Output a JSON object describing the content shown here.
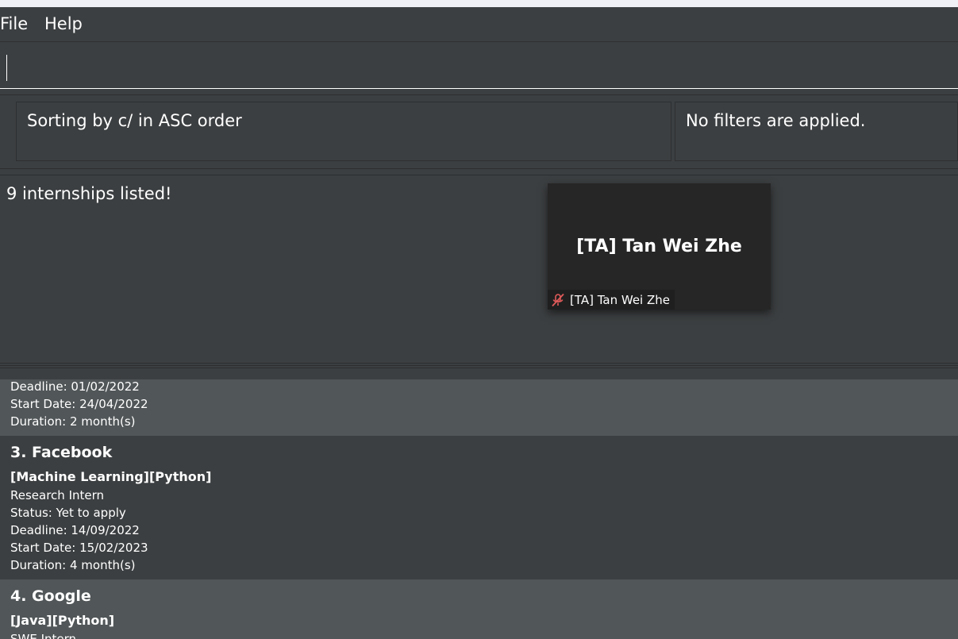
{
  "menu": {
    "file": "File",
    "help": "Help"
  },
  "command_box": {
    "value": ""
  },
  "sort_panel": {
    "text": "Sorting by c/ in ASC order"
  },
  "filter_panel": {
    "text": "No filters are applied."
  },
  "result_display": {
    "text": "9 internships listed!"
  },
  "video_overlay": {
    "name": "[TA] Tan Wei Zhe",
    "label": "[TA] Tan Wei Zhe",
    "icon": "mic-off-icon"
  },
  "internships": [
    {
      "deadline": "Deadline: 01/02/2022",
      "start": "Start Date: 24/04/2022",
      "duration": "Duration: 2 month(s)"
    },
    {
      "title": "3.  Facebook",
      "tags": "[Machine Learning][Python]",
      "role": "Research Intern",
      "status": "Status: Yet to apply",
      "deadline": "Deadline: 14/09/2022",
      "start": "Start Date: 15/02/2023",
      "duration": "Duration: 4 month(s)"
    },
    {
      "title": "4.  Google",
      "tags": "[Java][Python]",
      "role": "SWE Intern"
    }
  ],
  "colors": {
    "background": "#3c3f41",
    "alt_row": "#515658",
    "mic_off": "#e05a5a"
  }
}
